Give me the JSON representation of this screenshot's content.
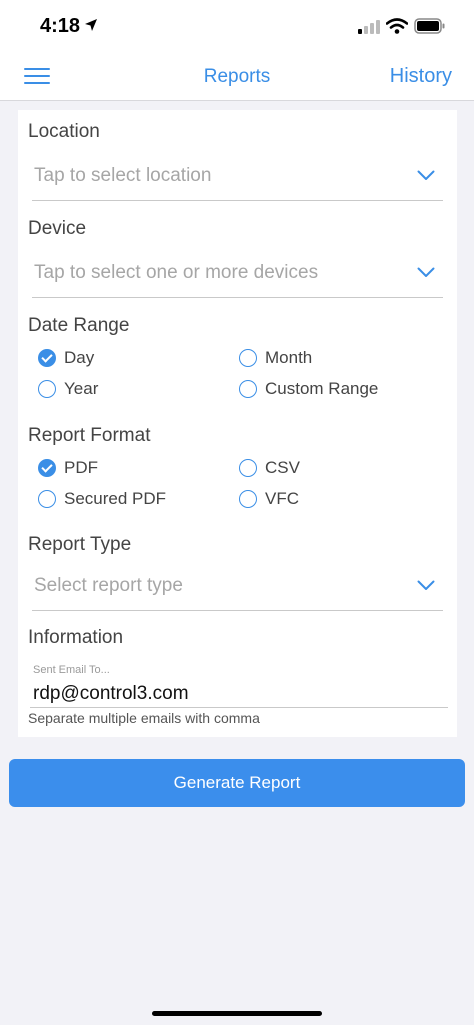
{
  "status": {
    "time": "4:18"
  },
  "nav": {
    "title": "Reports",
    "history_label": "History"
  },
  "form": {
    "location": {
      "label": "Location",
      "placeholder": "Tap to select location"
    },
    "device": {
      "label": "Device",
      "placeholder": "Tap to select one or more devices"
    },
    "date_range": {
      "label": "Date Range",
      "options": [
        "Day",
        "Month",
        "Year",
        "Custom Range"
      ],
      "selected": "Day"
    },
    "report_format": {
      "label": "Report Format",
      "options": [
        "PDF",
        "CSV",
        "Secured PDF",
        "VFC"
      ],
      "selected": "PDF"
    },
    "report_type": {
      "label": "Report Type",
      "placeholder": "Select report type"
    },
    "information": {
      "label": "Information",
      "email_caption": "Sent Email To...",
      "email_value": "rdp@control3.com",
      "email_help": "Separate multiple emails with comma"
    }
  },
  "generate_label": "Generate Report",
  "colors": {
    "accent": "#3a8ee6",
    "button": "#3b8eec",
    "background": "#f2f2f7"
  }
}
